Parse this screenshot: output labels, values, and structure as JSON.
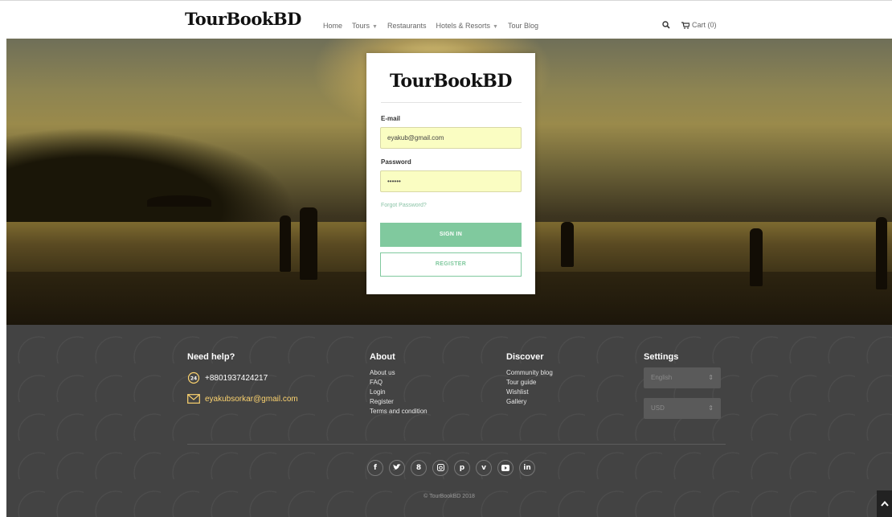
{
  "brand": {
    "name": "TourBookBD"
  },
  "nav": {
    "home": "Home",
    "tours": "Tours",
    "restaurants": "Restaurants",
    "hotels": "Hotels & Resorts",
    "blog": "Tour Blog",
    "search_icon": "search-icon",
    "cart": "Cart (0)"
  },
  "login": {
    "logo": "TourBookBD",
    "email_label": "E-mail",
    "email_value": "eyakub@gmail.com",
    "password_label": "Password",
    "password_value": "••••••",
    "forgot": "Forgot Password?",
    "signin": "SIGN IN",
    "register": "REGISTER"
  },
  "footer": {
    "help": {
      "title": "Need help?",
      "phone": "+8801937424217",
      "email": "eyakubsorkar@gmail.com"
    },
    "about": {
      "title": "About",
      "links": [
        "About us",
        "FAQ",
        "Login",
        "Register",
        "Terms and condition"
      ]
    },
    "discover": {
      "title": "Discover",
      "links": [
        "Community blog",
        "Tour guide",
        "Wishlist",
        "Gallery"
      ]
    },
    "settings": {
      "title": "Settings",
      "language": "English",
      "currency": "USD"
    },
    "socials": [
      "facebook-icon",
      "twitter-icon",
      "google-plus-icon",
      "instagram-icon",
      "pinterest-icon",
      "vimeo-icon",
      "youtube-icon",
      "linkedin-icon"
    ],
    "copyright": "© TourBookBD 2018"
  },
  "colors": {
    "accent": "#80c99e",
    "input_bg": "#fafdc2",
    "footer_bg": "#434343",
    "email_link": "#fcd36f"
  }
}
